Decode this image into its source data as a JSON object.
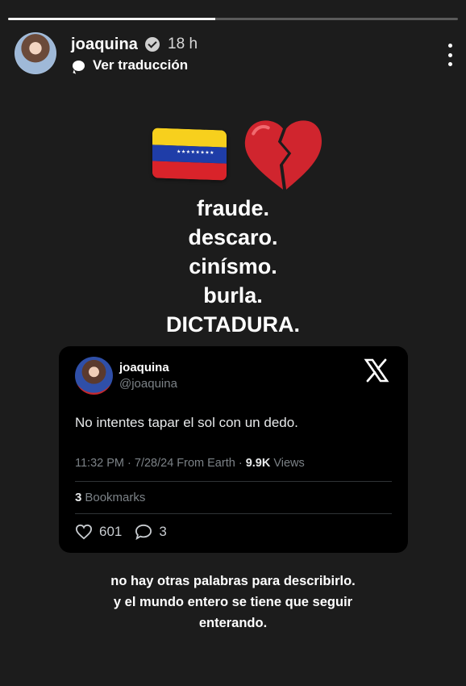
{
  "story": {
    "progress": 0.46,
    "username": "joaquina",
    "time": "18 h",
    "translate_label": "Ver traducción"
  },
  "emojis": [
    "venezuela-flag",
    "broken-heart"
  ],
  "words": [
    "fraude.",
    "descaro.",
    "cinísmo.",
    "burla.",
    "DICTADURA."
  ],
  "tweet": {
    "name": "joaquina",
    "handle": "@joaquina",
    "text": "No intentes tapar el sol con un dedo.",
    "meta": "11:32 PM · 7/28/24 From Earth · ",
    "views_count": "9.9K",
    "views_label": "Views",
    "bookmarks_count": "3",
    "bookmarks_label": "Bookmarks",
    "likes": "601",
    "replies": "3"
  },
  "caption": [
    "no hay otras palabras para describirlo.",
    "y el mundo entero se tiene que seguir",
    "enterando."
  ],
  "colors": {
    "background": "#1c1c1c",
    "tweet_card": "#000000",
    "muted": "#7c8287"
  }
}
